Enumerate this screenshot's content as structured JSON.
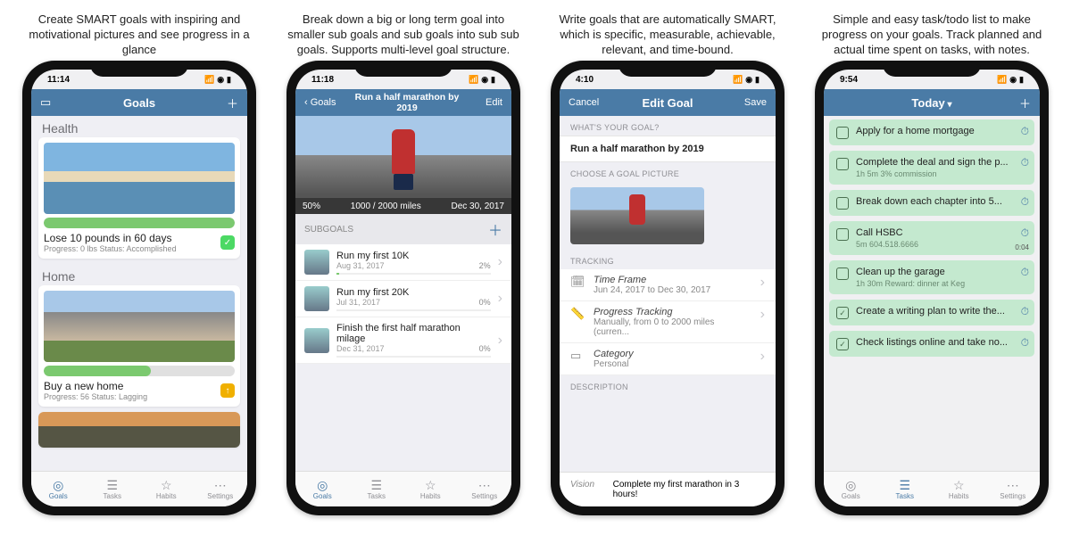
{
  "panels": [
    {
      "caption": "Create SMART goals with inspiring and motivational pictures and see progress in a glance",
      "time": "11:14",
      "nav": {
        "title": "Goals",
        "left_icon": "folder",
        "right_icon": "plus"
      },
      "sections": [
        {
          "title": "Health",
          "goal": {
            "title": "Lose 10 pounds in 60 days",
            "sub": "Progress: 0 lbs   Status: Accomplished",
            "progress": 100,
            "badge": "ok"
          }
        },
        {
          "title": "Home",
          "goal": {
            "title": "Buy a new home",
            "sub": "Progress: 56   Status: Lagging",
            "progress": 56,
            "badge": "warn"
          }
        }
      ],
      "tabs": [
        "Goals",
        "Tasks",
        "Habits",
        "Settings"
      ],
      "active_tab": 0
    },
    {
      "caption": "Break down a big or long term goal into smaller sub goals and sub goals into sub sub goals. Supports multi-level goal structure.",
      "time": "11:18",
      "nav": {
        "back": "Goals",
        "title": "Run a half marathon by 2019",
        "right": "Edit"
      },
      "hero": {
        "pct": "50%",
        "prog": "1000 / 2000 miles",
        "date": "Dec 30, 2017"
      },
      "subgoals_header": "SUBGOALS",
      "subgoals": [
        {
          "title": "Run my first 10K",
          "date": "Aug 31, 2017",
          "pct": "2%",
          "fill": 2
        },
        {
          "title": "Run my first 20K",
          "date": "Jul 31, 2017",
          "pct": "0%",
          "fill": 0
        },
        {
          "title": "Finish the first half marathon milage",
          "date": "Dec 31, 2017",
          "pct": "0%",
          "fill": 0
        }
      ],
      "tabs": [
        "Goals",
        "Tasks",
        "Habits",
        "Settings"
      ],
      "active_tab": 0
    },
    {
      "caption": "Write goals that are automatically SMART, which is specific, measurable, achievable, relevant, and time-bound.",
      "time": "4:10",
      "nav": {
        "left": "Cancel",
        "title": "Edit Goal",
        "right": "Save"
      },
      "q_header": "WHAT'S YOUR GOAL?",
      "goal_text": "Run a half marathon by 2019",
      "pic_header": "CHOOSE A GOAL PICTURE",
      "tracking_header": "TRACKING",
      "tracking": {
        "tf_label": "Time Frame",
        "tf_value": "Jun 24, 2017 to Dec 30, 2017",
        "pt_label": "Progress Tracking",
        "pt_value": "Manually, from 0 to 2000 miles (curren...",
        "cat_label": "Category",
        "cat_value": "Personal"
      },
      "desc_header": "DESCRIPTION",
      "vision_label": "Vision",
      "vision_value": "Complete my first marathon in 3 hours!"
    },
    {
      "caption": "Simple and easy task/todo list to make progress on your goals. Track planned and actual time spent on tasks, with notes.",
      "time": "9:54",
      "nav": {
        "title": "Today",
        "right_icon": "plus"
      },
      "tasks": [
        {
          "title": "Apply for a home mortgage",
          "timer": true
        },
        {
          "title": "Complete the deal and sign the p...",
          "sub": "1h 5m 3% commission",
          "timer": true
        },
        {
          "title": "Break down each chapter into 5...",
          "timer": true
        },
        {
          "title": "Call HSBC",
          "sub": "5m 604.518.6666",
          "timer": true,
          "elapsed": "0:04"
        },
        {
          "title": "Clean up the garage",
          "sub": "1h 30m Reward: dinner at Keg",
          "timer": true
        },
        {
          "title": "Create a writing plan to write the...",
          "checked": true,
          "timer": true
        },
        {
          "title": "Check listings online and take no...",
          "checked": true,
          "timer": true
        }
      ],
      "tabs": [
        "Goals",
        "Tasks",
        "Habits",
        "Settings"
      ],
      "active_tab": 1
    }
  ]
}
